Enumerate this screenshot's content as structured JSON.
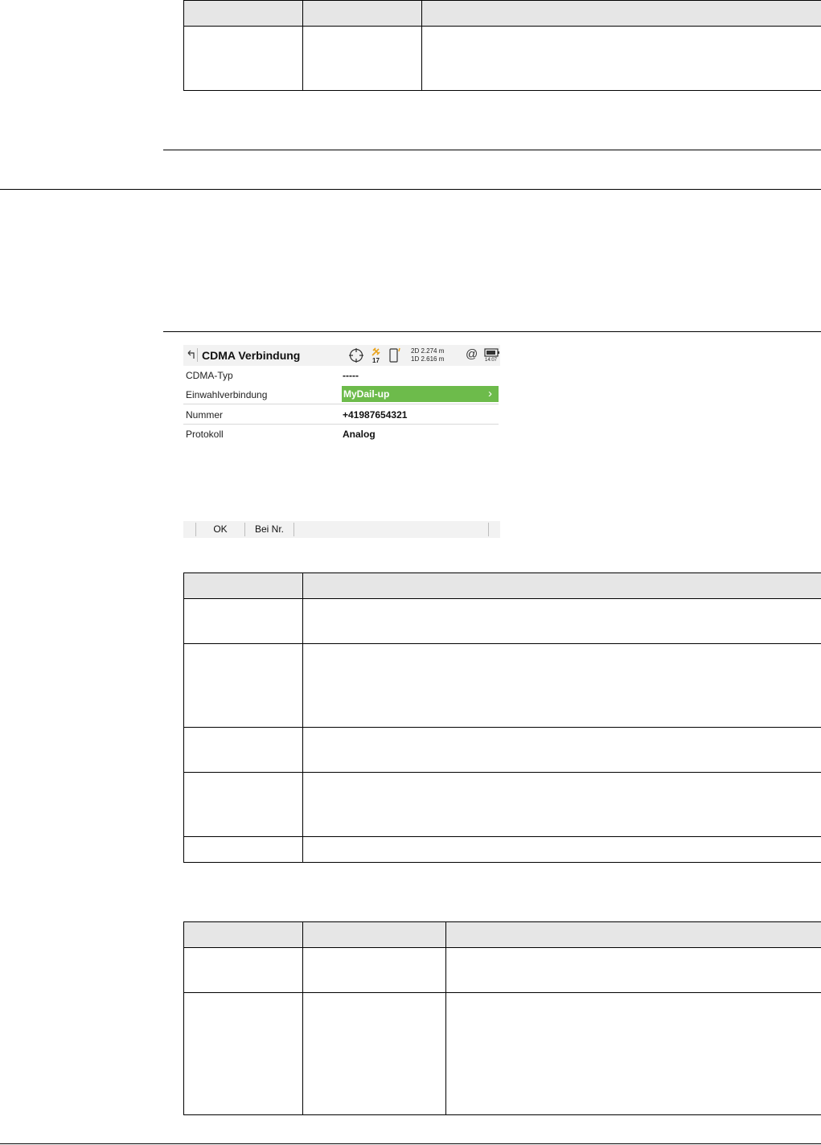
{
  "device": {
    "title": "CDMA Verbindung",
    "status": {
      "sat_count": "17",
      "accuracy_2d": "2D 2.274 m",
      "accuracy_1d": "1D 2.616 m",
      "battery_time": "14:07"
    },
    "rows": [
      {
        "label": "CDMA-Typ",
        "value": "-----"
      },
      {
        "label": "Einwahlverbindung",
        "value": "MyDail-up"
      },
      {
        "label": "Nummer",
        "value": "+41987654321"
      },
      {
        "label": "Protokoll",
        "value": "Analog"
      }
    ],
    "footer_buttons": [
      "OK",
      "Bei Nr."
    ]
  },
  "colors": {
    "accent_green": "#6dbb4b",
    "table_header": "#e6e6e6"
  },
  "icons": [
    "back-icon",
    "crosshair-icon",
    "satellite-icon",
    "device-icon",
    "at-icon",
    "battery-icon",
    "chevron-right-icon"
  ]
}
